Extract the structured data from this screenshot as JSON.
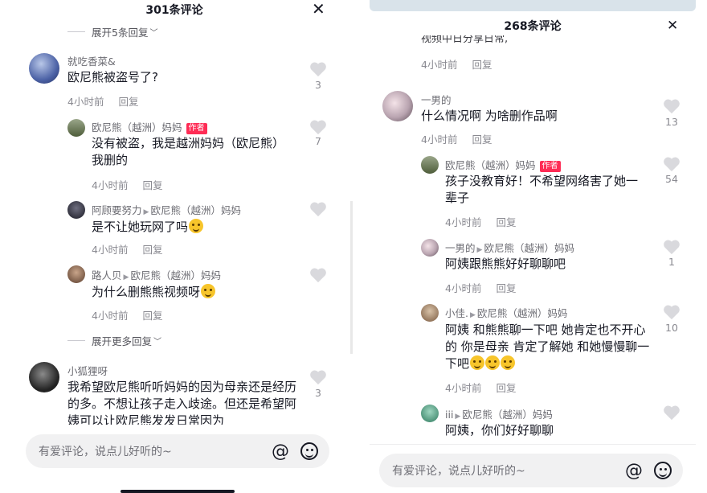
{
  "left": {
    "title": "301条评论",
    "close": "✕",
    "expand_top": "展开5条回复",
    "comments": [
      {
        "name": "就吃香菜&",
        "text": "欧尼熊被盗号了?",
        "time": "4小时前",
        "reply": "回复",
        "likes": "3"
      },
      {
        "name": "欧尼熊（越洲）妈妈",
        "tag": "作者",
        "text": "没有被盗，我是越洲妈妈（欧尼熊）我删的",
        "time": "4小时前",
        "reply": "回复",
        "likes": "7"
      },
      {
        "name": "阿顾要努力",
        "to": "欧尼熊（越洲）妈妈",
        "text": "是不让她玩网了吗",
        "time": "4小时前",
        "reply": "回复",
        "likes": ""
      },
      {
        "name": "路人贝",
        "to": "欧尼熊（越洲）妈妈",
        "text": "为什么删熊熊视频呀",
        "time": "4小时前",
        "reply": "回复",
        "likes": ""
      },
      {
        "name": "小狐狸呀",
        "text": "我希望欧尼熊听听妈妈的因为母亲还是经历的多。不想让孩子走入歧途。但还是希望阿姨可以让欧尼熊发发日常因为",
        "likes": "3"
      }
    ],
    "expand_more": "展开更多回复",
    "input_placeholder": "有爱评论，说点儿好听的~",
    "at_icon": "@"
  },
  "right": {
    "title": "268条评论",
    "close": "✕",
    "top_text": "视频中日分享日常,",
    "top_time": "4小时前",
    "top_reply": "回复",
    "comments": [
      {
        "name": "一男的",
        "text": "什么情况啊 为啥删作品啊",
        "time": "4小时前",
        "reply": "回复",
        "likes": "13"
      },
      {
        "name": "欧尼熊（越洲）妈妈",
        "tag": "作者",
        "text": "孩子没教育好！不希望网络害了她一辈子",
        "time": "4小时前",
        "reply": "回复",
        "likes": "54"
      },
      {
        "name": "一男的",
        "to": "欧尼熊（越洲）妈妈",
        "text": "阿姨跟熊熊好好聊聊吧",
        "time": "4小时前",
        "reply": "回复",
        "likes": "1"
      },
      {
        "name": "小佳.",
        "to": "欧尼熊（越洲）妈妈",
        "text": "阿姨 和熊熊聊一下吧 她肯定也不开心的 你是母亲 肯定了解她 和她慢慢聊一下吧",
        "time": "4小时前",
        "reply": "回复",
        "likes": "10"
      },
      {
        "name": "iii",
        "to": "欧尼熊（越洲）妈妈",
        "text": "阿姨，你们好好聊聊",
        "likes": ""
      }
    ],
    "input_placeholder": "有爱评论，说点儿好听的~",
    "at_icon": "@"
  },
  "colors": {
    "author_tag": "#fe2c55",
    "heart": "#d9d9dd",
    "input_bg": "#f1f1f2"
  }
}
